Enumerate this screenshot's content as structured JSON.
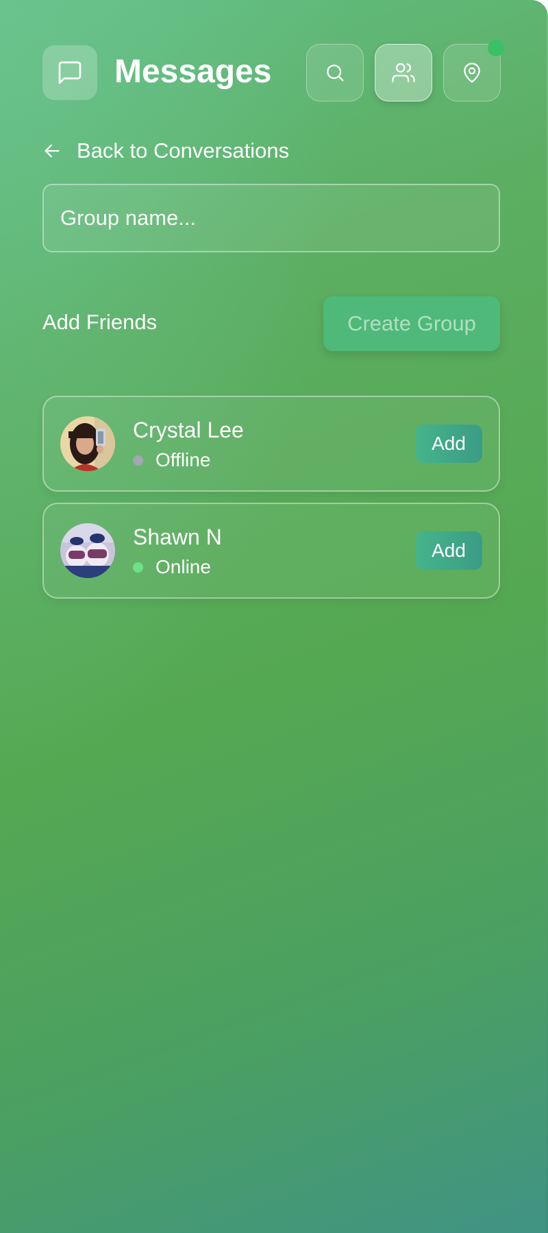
{
  "header": {
    "title": "Messages",
    "app_icon": "message-square-icon",
    "buttons": [
      {
        "name": "search",
        "icon": "search-icon",
        "active": false
      },
      {
        "name": "friends",
        "icon": "users-icon",
        "active": true
      },
      {
        "name": "location",
        "icon": "map-pin-icon",
        "active": false
      }
    ],
    "status_color": "#38c167"
  },
  "back_link": {
    "label": "Back to Conversations",
    "icon": "arrow-left-icon"
  },
  "group_form": {
    "name_placeholder": "Group name...",
    "name_value": "",
    "add_friends_label": "Add Friends",
    "create_button_label": "Create Group"
  },
  "friends": [
    {
      "name": "Crystal Lee",
      "status": "Offline",
      "status_color": "#a3a6b4",
      "action_label": "Add"
    },
    {
      "name": "Shawn N",
      "status": "Online",
      "status_color": "#6fe08a",
      "action_label": "Add"
    }
  ],
  "colors": {
    "gradient_start": "#63be84",
    "gradient_mid": "#55a852",
    "gradient_end": "#419384",
    "button_gradient": "#46b48a"
  }
}
